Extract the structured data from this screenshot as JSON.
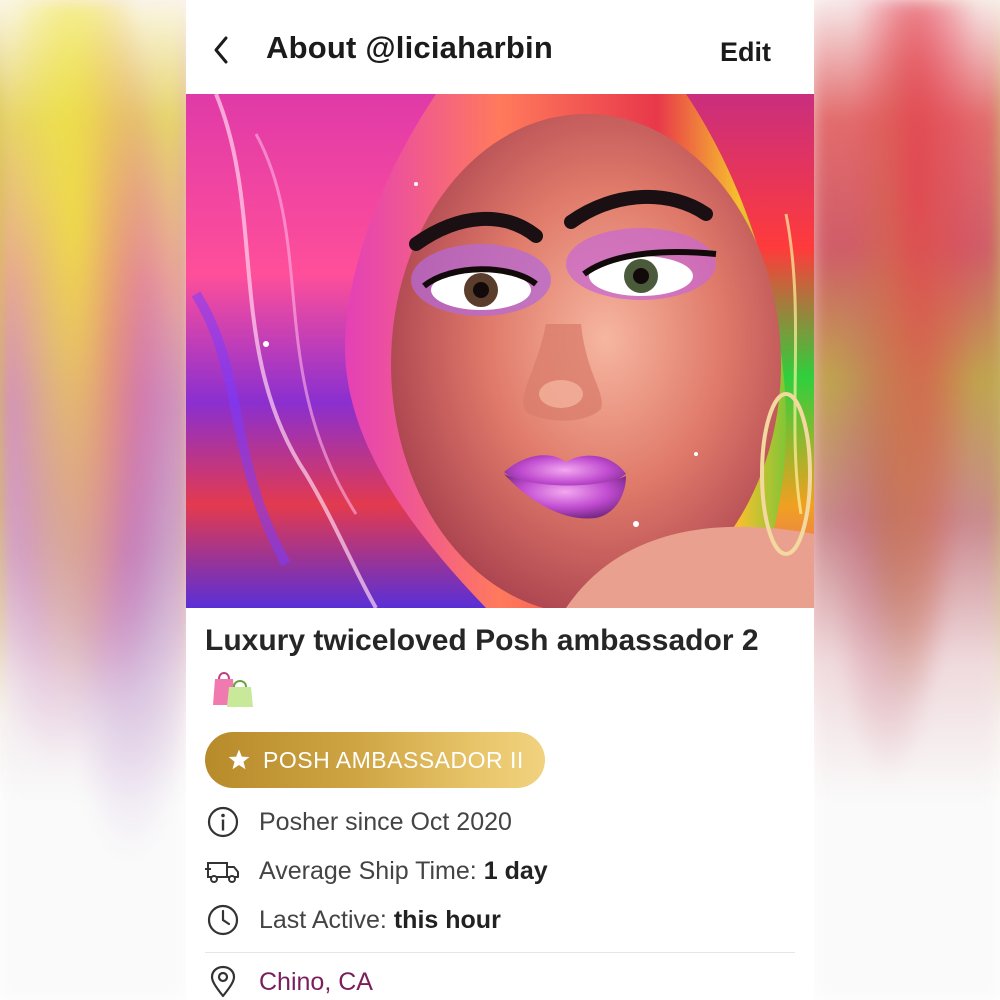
{
  "header": {
    "title": "About @liciaharbin",
    "edit_label": "Edit"
  },
  "profile": {
    "bio": "Luxury twiceloved Posh ambassador 2",
    "badge": "POSH AMBASSADOR II",
    "posher_since": "Posher since Oct 2020",
    "ship_time_label": "Average Ship Time:",
    "ship_time_value": "1 day",
    "last_active_label": "Last Active:",
    "last_active_value": "this hour",
    "location": "Chino, CA"
  },
  "icons": {
    "back": "chevron-left-icon",
    "bags": "shopping-bags-icon",
    "badge": "star-icon",
    "since": "info-circle-icon",
    "ship": "truck-icon",
    "active": "clock-icon",
    "location": "map-pin-icon"
  },
  "colors": {
    "badge_gold": "#cfa544",
    "location_link": "#7a1f5c",
    "text_dark": "#1b1b1b"
  }
}
